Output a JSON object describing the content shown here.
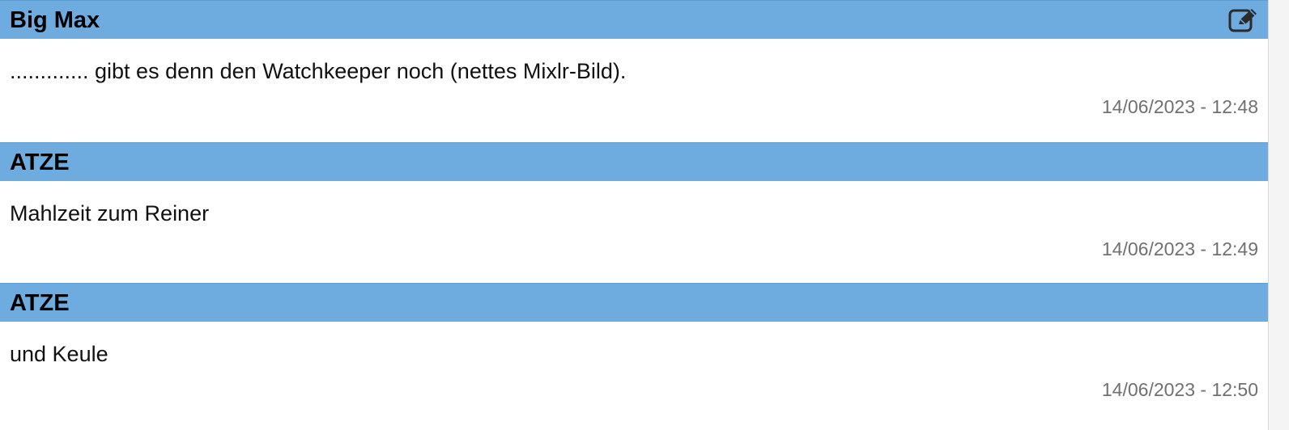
{
  "posts": [
    {
      "author": "Big Max",
      "text": "............. gibt es denn den Watchkeeper noch (nettes Mixlr-Bild).",
      "timestamp": "14/06/2023 - 12:48",
      "editable": true
    },
    {
      "author": "ATZE",
      "text": "Mahlzeit zum Reiner",
      "timestamp": "14/06/2023 - 12:49",
      "editable": false
    },
    {
      "author": "ATZE",
      "text": "und Keule",
      "timestamp": "14/06/2023 - 12:50",
      "editable": false
    }
  ],
  "icons": {
    "edit": "edit-icon"
  },
  "colors": {
    "header_bg": "#6eabdf",
    "timestamp": "#707070"
  }
}
